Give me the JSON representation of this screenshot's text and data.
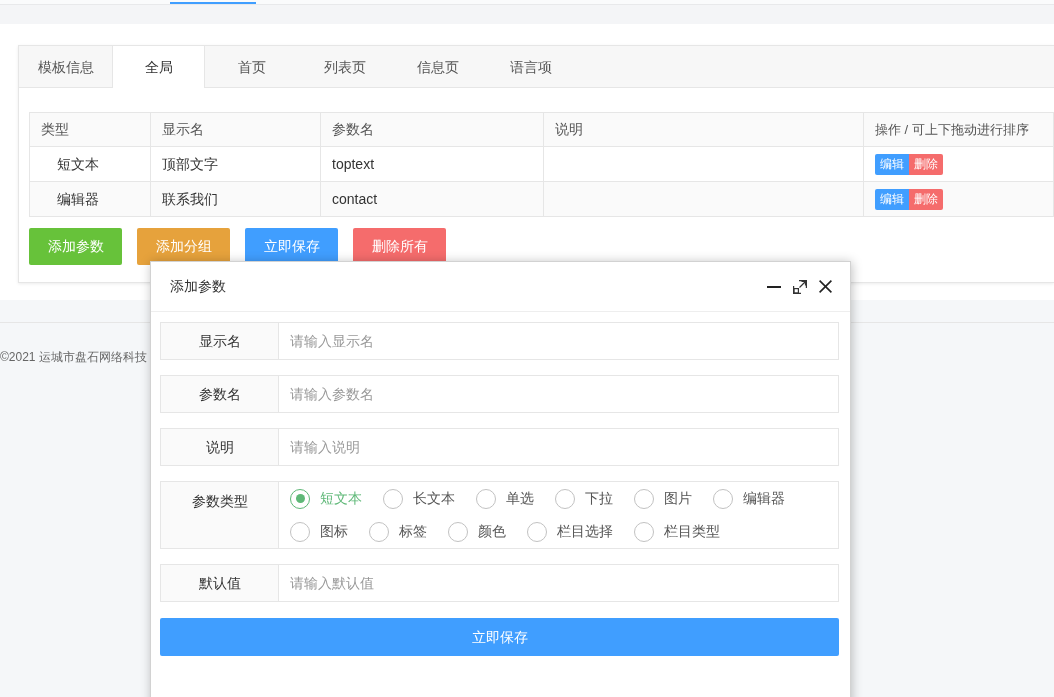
{
  "tabs": [
    {
      "label": "模板信息",
      "selected": false
    },
    {
      "label": "全局",
      "selected": true
    },
    {
      "label": "首页",
      "selected": false
    },
    {
      "label": "列表页",
      "selected": false
    },
    {
      "label": "信息页",
      "selected": false
    },
    {
      "label": "语言项",
      "selected": false
    }
  ],
  "table": {
    "columns": [
      "类型",
      "显示名",
      "参数名",
      "说明",
      "操作 / 可上下拖动进行排序"
    ],
    "rows": [
      {
        "type": "短文本",
        "display_name": "顶部文字",
        "param_name": "toptext",
        "actions": [
          {
            "label": "编辑",
            "kind": "edit"
          },
          {
            "label": "删除",
            "kind": "delete"
          }
        ]
      },
      {
        "type": "编辑器",
        "display_name": "联系我们",
        "param_name": "contact",
        "actions": [
          {
            "label": "编辑",
            "kind": "edit"
          },
          {
            "label": "删除",
            "kind": "delete"
          }
        ]
      }
    ]
  },
  "buttons": [
    {
      "label": "添加参数",
      "kind": "success"
    },
    {
      "label": "添加分组",
      "kind": "warning"
    },
    {
      "label": "立即保存",
      "kind": "primary"
    },
    {
      "label": "删除所有",
      "kind": "danger"
    }
  ],
  "footer": {
    "copyright": "©2021 运城市盘石网络科技"
  },
  "dialog": {
    "title": "添加参数",
    "fields": [
      {
        "label": "显示名",
        "kind": "text",
        "placeholder": "请输入显示名"
      },
      {
        "label": "参数名",
        "kind": "text",
        "placeholder": "请输入参数名"
      },
      {
        "label": "说明",
        "kind": "text",
        "placeholder": "请输入说明"
      },
      {
        "label": "参数类型",
        "kind": "radio",
        "options": [
          {
            "label": "短文本",
            "selected": true
          },
          {
            "label": "长文本",
            "selected": false
          },
          {
            "label": "单选",
            "selected": false
          },
          {
            "label": "下拉",
            "selected": false
          },
          {
            "label": "图片",
            "selected": false
          },
          {
            "label": "编辑器",
            "selected": false
          },
          {
            "label": "图标",
            "selected": false
          },
          {
            "label": "标签",
            "selected": false
          },
          {
            "label": "颜色",
            "selected": false
          },
          {
            "label": "栏目选择",
            "selected": false
          },
          {
            "label": "栏目类型",
            "selected": false
          }
        ]
      },
      {
        "label": "默认值",
        "kind": "text",
        "placeholder": "请输入默认值"
      }
    ],
    "submit": "立即保存"
  }
}
